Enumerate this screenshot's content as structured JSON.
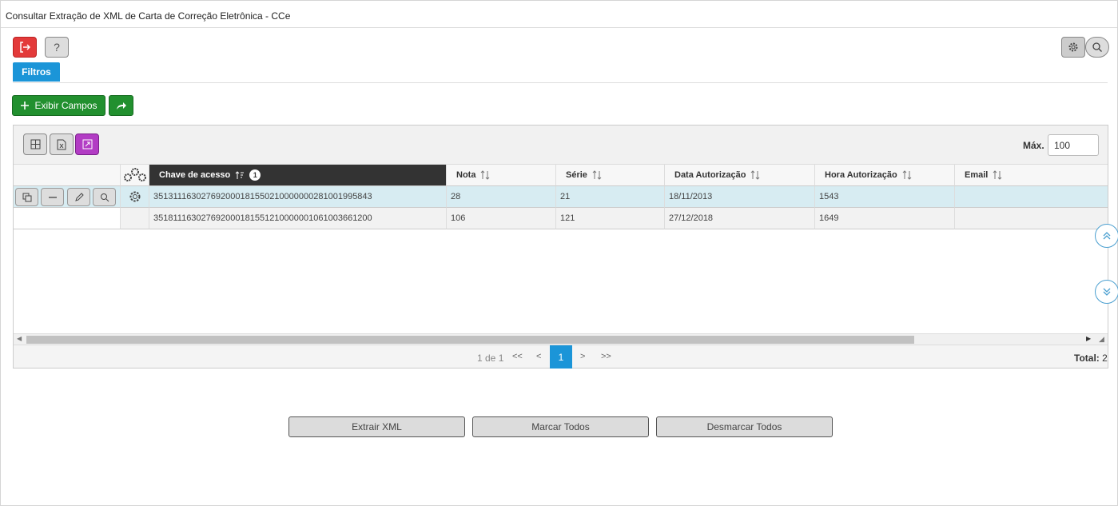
{
  "window": {
    "title": "Consultar Extração de XML de Carta de Correção Eletrônica - CCe"
  },
  "toolbar": {
    "exit_icon": "exit-icon",
    "help_label": "?",
    "settings_icon": "gear-icon",
    "search_icon": "search-icon"
  },
  "tabs": [
    {
      "label": "Filtros"
    }
  ],
  "actions": {
    "show_fields_label": "Exibir Campos",
    "share_icon": "share-arrow-icon"
  },
  "grid": {
    "max_label": "Máx.",
    "max_value": "100",
    "columns": [
      {
        "label": "Chave de acesso",
        "sort_order": "1"
      },
      {
        "label": "Nota"
      },
      {
        "label": "Série"
      },
      {
        "label": "Data Autorização"
      },
      {
        "label": "Hora Autorização"
      },
      {
        "label": "Email"
      }
    ],
    "rows": [
      {
        "chave": "35131116302769200018155021000000028100199584​3",
        "nota": "28",
        "serie": "21",
        "data": "18/11/2013",
        "hora": "1543",
        "email": ""
      },
      {
        "chave": "35181116302769200018155121000000106100366120​0",
        "nota": "106",
        "serie": "121",
        "data": "27/12/2018",
        "hora": "1649",
        "email": ""
      }
    ],
    "pager": {
      "info": "1 de 1",
      "first": "<<",
      "prev": "<",
      "current": "1",
      "next": ">",
      "last": ">>",
      "total_label": "Total:",
      "total_value": "2"
    }
  },
  "bottom_buttons": {
    "extract": "Extrair XML",
    "mark_all": "Marcar Todos",
    "unmark_all": "Desmarcar Todos"
  },
  "colors": {
    "primary": "#1b95d8",
    "success": "#22902f",
    "danger": "#e33a3a",
    "purple": "#b23cc4",
    "selected_row": "#d7ecf2"
  }
}
